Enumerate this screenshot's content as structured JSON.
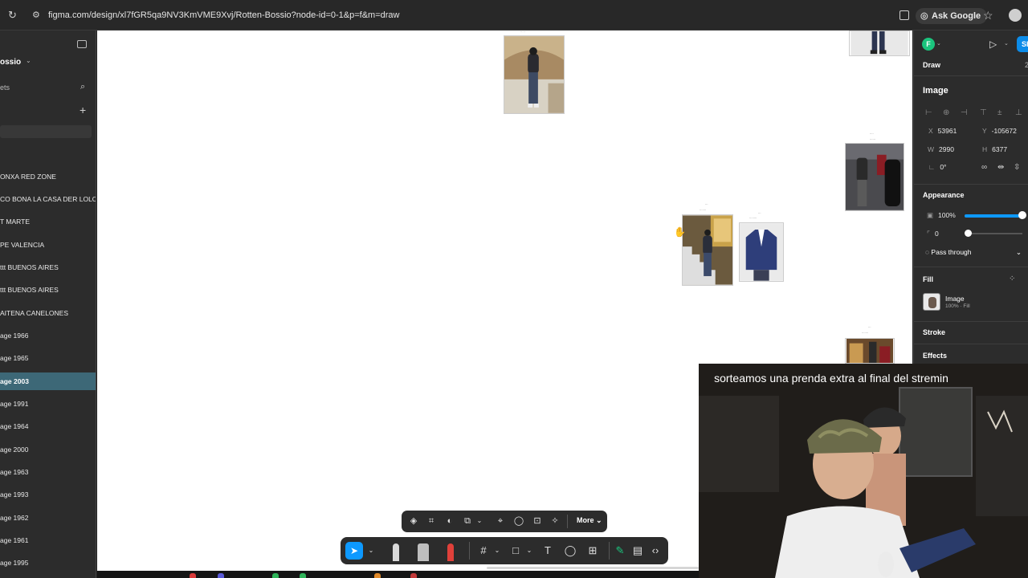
{
  "browser": {
    "url": "figma.com/design/xl7fGR5qa9NV3KmVME9Xvj/Rotten-Bossio?node-id=0-1&p=f&m=draw",
    "ask_google": "Ask Google"
  },
  "left_panel": {
    "project": "ossio",
    "assets_label": "ets",
    "layers": [
      {
        "label": "ONXA RED ZONE"
      },
      {
        "label": "CO BONA LA CASA DER LOLO M"
      },
      {
        "label": "T MARTE"
      },
      {
        "label": "PE VALENCIA"
      },
      {
        "label": "ttt BUENOS AIRES"
      },
      {
        "label": "ttt BUENOS AIRES"
      },
      {
        "label": "AITENA CANELONES"
      },
      {
        "label": "age 1966"
      },
      {
        "label": "age 1965"
      },
      {
        "label": "age 2003",
        "selected": true
      },
      {
        "label": "age 1991"
      },
      {
        "label": "age 1964"
      },
      {
        "label": "age 2000"
      },
      {
        "label": "age 1963"
      },
      {
        "label": "age 1993"
      },
      {
        "label": "age 1962"
      },
      {
        "label": "age 1961"
      },
      {
        "label": "age 1995"
      }
    ]
  },
  "context_toolbar": {
    "more_label": "More"
  },
  "right_panel": {
    "avatar_initial": "F",
    "share_label": "Sh",
    "mode_label": "Draw",
    "mode_value": "2",
    "section_title": "Image",
    "x_label": "X",
    "x_value": "53961",
    "y_label": "Y",
    "y_value": "-105672",
    "w_label": "W",
    "w_value": "2990",
    "h_label": "H",
    "h_value": "6377",
    "rotation_value": "0°",
    "appearance_title": "Appearance",
    "opacity_value": "100%",
    "opacity_fraction": 1.0,
    "corner_value": "0",
    "blend_mode": "Pass through",
    "fill_title": "Fill",
    "fill_name": "Image",
    "fill_sub": "100% · Fill",
    "stroke_title": "Stroke",
    "effects_title": "Effects"
  },
  "webcam": {
    "subtitle": "sorteamos una prenda extra al final del stremin"
  },
  "colors": {
    "accent": "#0d99ff",
    "selected_layer": "#3d6877",
    "panel_bg": "#2c2c2c",
    "canvas_bg": "#ffffff"
  }
}
